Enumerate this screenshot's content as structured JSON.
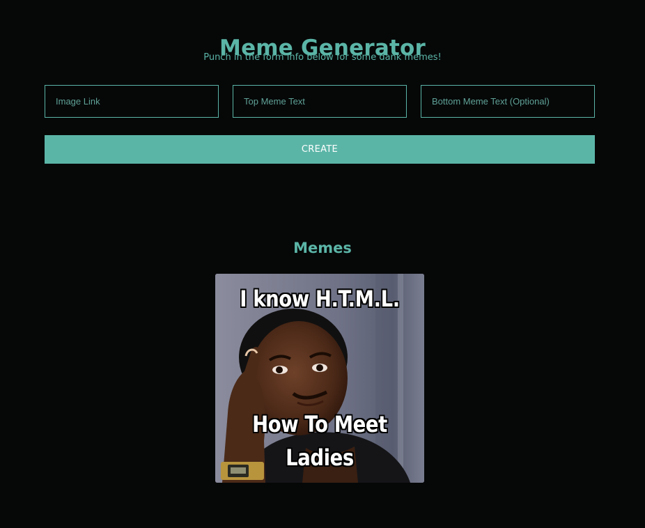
{
  "header": {
    "title": "Meme Generator",
    "subtitle": "Punch in the form info below for some dank memes!"
  },
  "form": {
    "image_link_placeholder": "Image Link",
    "top_text_placeholder": "Top Meme Text",
    "bottom_text_placeholder": "Bottom Meme Text (Optional)",
    "create_label": "CREATE"
  },
  "memes_section": {
    "title": "Memes",
    "items": [
      {
        "top_text": "I know H.T.M.L.",
        "bottom_text": "How To Meet Ladies"
      }
    ]
  },
  "theme": {
    "background": "#060808",
    "accent": "#5bb5a7",
    "button_text": "#ffffff"
  }
}
